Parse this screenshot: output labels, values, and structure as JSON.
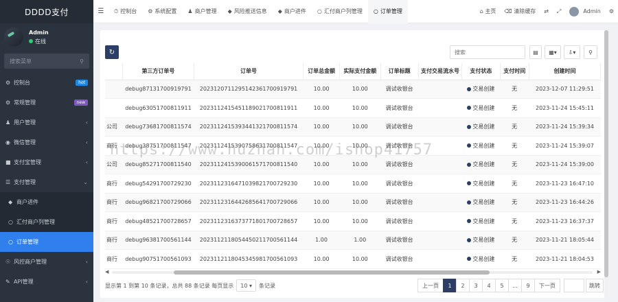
{
  "sidebar": {
    "brand": "DDDD支付",
    "user": {
      "name": "Admin",
      "status": "在线"
    },
    "search_placeholder": "搜索菜单",
    "items": [
      {
        "label": "控制台",
        "badge": "hot"
      },
      {
        "label": "常规管理",
        "badge": "new"
      },
      {
        "label": "用户管理"
      },
      {
        "label": "微信管理"
      },
      {
        "label": "支付宝管理"
      },
      {
        "label": "支付管理"
      }
    ],
    "submenu": [
      {
        "label": "商户进件"
      },
      {
        "label": "汇付商户列管理"
      },
      {
        "label": "订单管理"
      }
    ],
    "items_after": [
      {
        "label": "风控商户管理"
      },
      {
        "label": "API管理"
      }
    ]
  },
  "topnav": {
    "tabs": [
      "控制台",
      "系统配置",
      "商户管理",
      "风险推送信息",
      "商户进件",
      "汇付商户列管理",
      "订单管理"
    ],
    "home": "主页",
    "clear_cache": "清除缓存",
    "admin": "Admin"
  },
  "toolbar": {
    "search_placeholder": "搜索"
  },
  "table": {
    "headers": [
      "",
      "第三方订单号",
      "订单号",
      "订单总金额",
      "实际支付金额",
      "订单标题",
      "支付交易流水号",
      "支付状态",
      "支付时间",
      "创建时间"
    ],
    "rows": [
      [
        "",
        "debug87131700919791",
        "2023120711295142361700919791",
        "10.00",
        "10.00",
        "调试收银台",
        "",
        "交易创建",
        "无",
        "2023-12-07 11:29:51"
      ],
      [
        "",
        "debug63051700811911",
        "2023112415451189021700811911",
        "10.00",
        "10.00",
        "调试收银台",
        "",
        "交易创建",
        "无",
        "2023-11-24 15:45:11"
      ],
      [
        "公司",
        "debug73681700811574",
        "2023112415393441321700811574",
        "10.00",
        "10.00",
        "调试收银台",
        "",
        "交易创建",
        "无",
        "2023-11-24 15:39:34"
      ],
      [
        "商行",
        "debug38751700811547",
        "2023112415390758631700811547",
        "10.00",
        "10.00",
        "调试收银台",
        "",
        "交易创建",
        "无",
        "2023-11-24 15:39:07"
      ],
      [
        "公司",
        "debug85271700811540",
        "2023112415390061571700811540",
        "10.00",
        "10.00",
        "调试收银台",
        "",
        "交易创建",
        "无",
        "2023-11-24 15:39:00"
      ],
      [
        "商行",
        "debug54291700729230",
        "2023112316471039821700729230",
        "10.00",
        "10.00",
        "调试收银台",
        "",
        "交易创建",
        "无",
        "2023-11-23 16:47:10"
      ],
      [
        "商行",
        "debug96821700729066",
        "2023112316442685641700729066",
        "10.00",
        "10.00",
        "调试收银台",
        "",
        "交易创建",
        "无",
        "2023-11-23 16:44:26"
      ],
      [
        "商行",
        "debug48521700728657",
        "2023112316373771801700728657",
        "10.00",
        "10.00",
        "调试收银台",
        "",
        "交易创建",
        "无",
        "2023-11-23 16:37:37"
      ],
      [
        "商行",
        "debug96381700561144",
        "2023112118054450211700561144",
        "1.00",
        "1.00",
        "调试收银台",
        "",
        "交易创建",
        "无",
        "2023-11-21 18:05:44"
      ],
      [
        "商行",
        "debug90751700561093",
        "2023112118045345981700561093",
        "10.00",
        "10.00",
        "调试收银台",
        "",
        "交易创建",
        "无",
        "2023-11-21 18:04:53"
      ]
    ]
  },
  "footer": {
    "summary_pre": "显示第 1 到第 10 条记录，总共 88 条记录 每页显示",
    "page_size": "10",
    "summary_post": "条记录"
  },
  "pager": {
    "prev": "上一页",
    "pages": [
      "1",
      "2",
      "3",
      "4",
      "5",
      "...",
      "9"
    ],
    "next": "下一页",
    "go": "跳转"
  },
  "watermark": "https://www.huzhan.com/ishop41757",
  "colors": {
    "sidebar": "#2b333e",
    "active": "#2f80ed",
    "primary": "#2c3e66"
  }
}
